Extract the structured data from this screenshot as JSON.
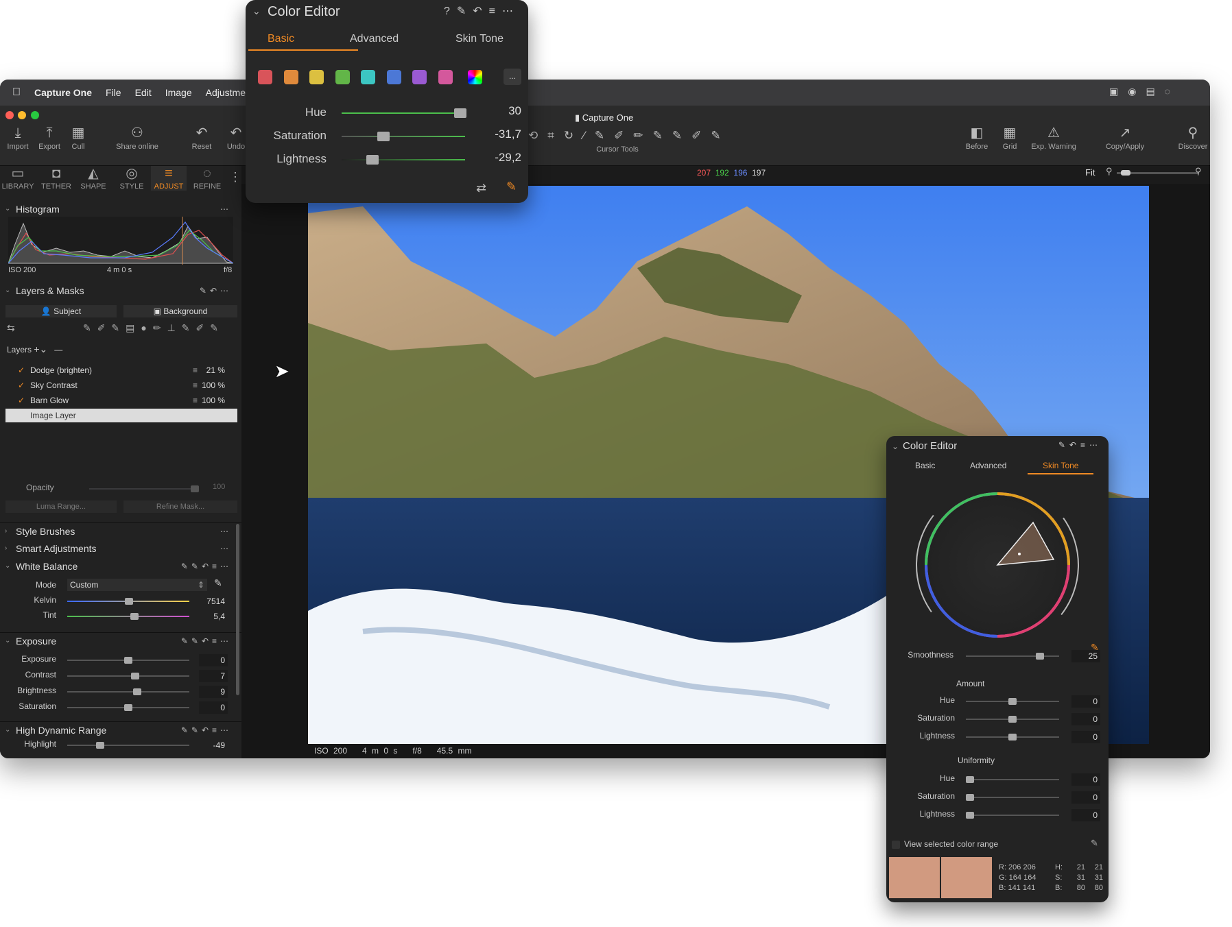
{
  "menubar": {
    "app": "Capture One",
    "items": [
      "File",
      "Edit",
      "Image",
      "Adjustments"
    ]
  },
  "window_title": "Capture One",
  "toolbar": {
    "import": "Import",
    "export": "Export",
    "cull": "Cull",
    "share": "Share online",
    "reset": "Reset",
    "undo": "Undo",
    "cursor_tools": "Cursor Tools",
    "before": "Before",
    "grid": "Grid",
    "exp_warning": "Exp. Warning",
    "copy_apply": "Copy/Apply",
    "discover": "Discover"
  },
  "rgb_readout": {
    "r": "207",
    "g": "192",
    "b": "196",
    "a": "197"
  },
  "fit_label": "Fit",
  "navtabs": [
    "LIBRARY",
    "TETHER",
    "SHAPE",
    "STYLE",
    "ADJUST",
    "REFINE"
  ],
  "histogram": {
    "title": "Histogram",
    "iso": "ISO 200",
    "shutter": "4 m 0 s",
    "aperture": "f/8"
  },
  "layers": {
    "title": "Layers & Masks",
    "subject": "Subject",
    "background": "Background",
    "layers_label": "Layers",
    "items": [
      {
        "name": "Dodge (brighten)",
        "pct": "21 %"
      },
      {
        "name": "Sky Contrast",
        "pct": "100 %"
      },
      {
        "name": "Barn Glow",
        "pct": "100 %"
      }
    ],
    "image_layer": "Image Layer",
    "opacity_label": "Opacity",
    "opacity_value": "100",
    "luma_range": "Luma Range...",
    "refine_mask": "Refine Mask..."
  },
  "sections": {
    "style_brushes": "Style Brushes",
    "smart_adjustments": "Smart Adjustments",
    "white_balance": "White Balance",
    "exposure": "Exposure",
    "hdr": "High Dynamic Range"
  },
  "white_balance": {
    "mode_label": "Mode",
    "mode_value": "Custom",
    "kelvin_label": "Kelvin",
    "kelvin": "7514",
    "tint_label": "Tint",
    "tint": "5,4"
  },
  "exposure": [
    {
      "label": "Exposure",
      "value": "0",
      "pos": 0.5
    },
    {
      "label": "Contrast",
      "value": "7",
      "pos": 0.56
    },
    {
      "label": "Brightness",
      "value": "9",
      "pos": 0.58
    },
    {
      "label": "Saturation",
      "value": "0",
      "pos": 0.5
    }
  ],
  "hdr": {
    "highlight_label": "Highlight",
    "highlight": "-49"
  },
  "photo_info": {
    "iso": "ISO 200",
    "shutter": "4 m 0 s",
    "aperture": "f/8",
    "focal": "45.5 mm"
  },
  "ce1": {
    "title": "Color Editor",
    "tabs": [
      "Basic",
      "Advanced",
      "Skin Tone"
    ],
    "hue_label": "Hue",
    "hue": "30",
    "sat_label": "Saturation",
    "sat": "-31,7",
    "light_label": "Lightness",
    "light": "-29,2",
    "more": "..."
  },
  "swatches": [
    "#d9545a",
    "#e08a3c",
    "#dcc040",
    "#62b648",
    "#3cc6c2",
    "#4c78d6",
    "#9a5ad2",
    "#d4589c"
  ],
  "ce2": {
    "title": "Color Editor",
    "tabs": [
      "Basic",
      "Advanced",
      "Skin Tone"
    ],
    "smoothness_label": "Smoothness",
    "smoothness": "25",
    "amount": "Amount",
    "uniformity": "Uniformity",
    "hue_label": "Hue",
    "sat_label": "Saturation",
    "light_label": "Lightness",
    "a_hue": "0",
    "a_sat": "0",
    "a_light": "0",
    "u_hue": "0",
    "u_sat": "0",
    "u_light": "0",
    "view_range": "View selected color range",
    "readout": [
      "R: 206 206",
      "G: 164 164",
      "B: 141 141"
    ],
    "hsb": [
      "H:",
      "S:",
      "B:"
    ],
    "hsb_a": [
      "21",
      "31",
      "80"
    ],
    "hsb_b": [
      "21",
      "31",
      "80"
    ]
  }
}
